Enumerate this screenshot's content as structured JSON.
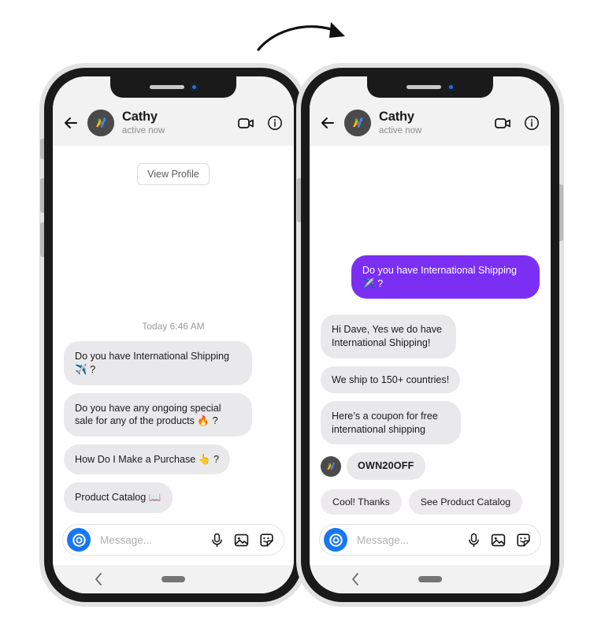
{
  "arrow": {
    "name": "curved-arrow"
  },
  "colors": {
    "outgoing_bubble": "#7b2ff2",
    "incoming_bubble": "#e9e9eb",
    "header_bg": "#f2f2f2",
    "camera_button": "#1877f2",
    "phone_frame": "#1a1a1a"
  },
  "phones": [
    {
      "id": "phone-left",
      "header": {
        "back_icon": "back-arrow-icon",
        "avatar_icon": "contact-avatar",
        "name": "Cathy",
        "presence": "active now",
        "video_icon": "video-camera-icon",
        "info_icon": "info-circle-icon"
      },
      "view_profile_label": "View Profile",
      "timestamp": "Today 6:46 AM",
      "messages": [
        {
          "side": "in",
          "text": "Do you have International Shipping ✈️ ?"
        },
        {
          "side": "in",
          "text": "Do you have any ongoing special sale for any of the products 🔥 ?"
        },
        {
          "side": "in",
          "text": "How Do I Make a Purchase 👆 ?"
        },
        {
          "side": "in",
          "text": "Product Catalog 📖"
        }
      ],
      "quick_replies": [],
      "composer": {
        "camera_icon": "camera-icon",
        "placeholder": "Message...",
        "value": "",
        "mic_icon": "microphone-icon",
        "gallery_icon": "image-gallery-icon",
        "sticker_icon": "sticker-icon"
      },
      "navbar": {
        "back_icon": "nav-back-icon",
        "home_pill": "nav-home-pill"
      }
    },
    {
      "id": "phone-right",
      "header": {
        "back_icon": "back-arrow-icon",
        "avatar_icon": "contact-avatar",
        "name": "Cathy",
        "presence": "active now",
        "video_icon": "video-camera-icon",
        "info_icon": "info-circle-icon"
      },
      "messages": [
        {
          "side": "out",
          "text": "Do you have International Shipping ✈️ ?"
        },
        {
          "side": "in",
          "text": "Hi Dave, Yes we do have International Shipping!"
        },
        {
          "side": "in",
          "text": "We ship to 150+ countries!"
        },
        {
          "side": "in",
          "text": "Here’s a coupon for free international shipping"
        },
        {
          "side": "in",
          "text": "OWN20OFF",
          "with_avatar": true,
          "code": true
        }
      ],
      "quick_replies": [
        "Cool! Thanks",
        "See Product Catalog"
      ],
      "composer": {
        "camera_icon": "camera-icon",
        "placeholder": "Message...",
        "value": "",
        "mic_icon": "microphone-icon",
        "gallery_icon": "image-gallery-icon",
        "sticker_icon": "sticker-icon"
      },
      "navbar": {
        "back_icon": "nav-back-icon",
        "home_pill": "nav-home-pill"
      }
    }
  ]
}
